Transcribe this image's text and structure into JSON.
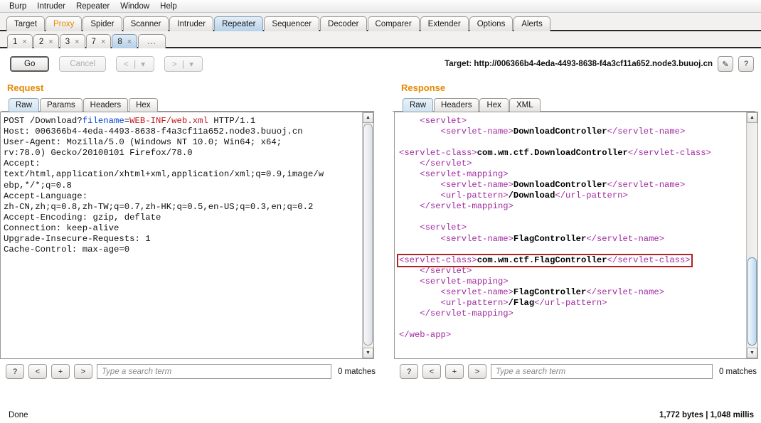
{
  "menu": {
    "items": [
      "Burp",
      "Intruder",
      "Repeater",
      "Window",
      "Help"
    ]
  },
  "main_tabs": [
    {
      "label": "Target",
      "state": "normal"
    },
    {
      "label": "Proxy",
      "state": "orange"
    },
    {
      "label": "Spider",
      "state": "normal"
    },
    {
      "label": "Scanner",
      "state": "normal"
    },
    {
      "label": "Intruder",
      "state": "normal"
    },
    {
      "label": "Repeater",
      "state": "active"
    },
    {
      "label": "Sequencer",
      "state": "normal"
    },
    {
      "label": "Decoder",
      "state": "normal"
    },
    {
      "label": "Comparer",
      "state": "normal"
    },
    {
      "label": "Extender",
      "state": "normal"
    },
    {
      "label": "Options",
      "state": "normal"
    },
    {
      "label": "Alerts",
      "state": "normal"
    }
  ],
  "repeater_tabs": [
    {
      "label": "1",
      "close": "×",
      "active": false
    },
    {
      "label": "2",
      "close": "×",
      "active": false
    },
    {
      "label": "3",
      "close": "×",
      "active": false
    },
    {
      "label": "7",
      "close": "×",
      "active": false
    },
    {
      "label": "8",
      "close": "×",
      "active": true
    }
  ],
  "repeater_tab_more": "...",
  "controls": {
    "go": "Go",
    "cancel": "Cancel",
    "back": "< | ▾",
    "forward": "> | ▾",
    "target_label": "Target: http://006366b4-4eda-4493-8638-f4a3cf11a652.node3.buuoj.cn",
    "edit_icon": "✎",
    "help_icon": "?"
  },
  "request": {
    "title": "Request",
    "tabs": [
      {
        "label": "Raw",
        "active": true
      },
      {
        "label": "Params",
        "active": false
      },
      {
        "label": "Headers",
        "active": false
      },
      {
        "label": "Hex",
        "active": false
      }
    ],
    "lines": [
      "POST /Download?filename=WEB-INF/web.xml HTTP/1.1",
      "Host: 006366b4-4eda-4493-8638-f4a3cf11a652.node3.buuoj.cn",
      "User-Agent: Mozilla/5.0 (Windows NT 10.0; Win64; x64;",
      "rv:78.0) Gecko/20100101 Firefox/78.0",
      "Accept:",
      "text/html,application/xhtml+xml,application/xml;q=0.9,image/w",
      "ebp,*/*;q=0.8",
      "Accept-Language:",
      "zh-CN,zh;q=0.8,zh-TW;q=0.7,zh-HK;q=0.5,en-US;q=0.3,en;q=0.2",
      "Accept-Encoding: gzip, deflate",
      "Connection: keep-alive",
      "Upgrade-Insecure-Requests: 1",
      "Cache-Control: max-age=0"
    ],
    "first_line": {
      "method": "POST /Download?",
      "param_key": "filename",
      "equals": "=",
      "param_value": "WEB-INF/web.xml",
      "protocol": " HTTP/1.1"
    },
    "search_placeholder": "Type a search term",
    "search_value": "",
    "matches": "0 matches",
    "buttons": [
      "?",
      "<",
      "+",
      ">"
    ]
  },
  "response": {
    "title": "Response",
    "tabs": [
      {
        "label": "Raw",
        "active": true
      },
      {
        "label": "Headers",
        "active": false
      },
      {
        "label": "Hex",
        "active": false
      },
      {
        "label": "XML",
        "active": false
      }
    ],
    "xml_lines": [
      {
        "indent": 4,
        "tag_open": "<servlet>",
        "value": "",
        "tag_close": "",
        "highlight": false
      },
      {
        "indent": 8,
        "tag_open": "<servlet-name>",
        "value": "DownloadController",
        "tag_close": "</servlet-name>",
        "highlight": false
      },
      {
        "indent": 0,
        "tag_open": "",
        "value": "",
        "tag_close": "",
        "highlight": false
      },
      {
        "indent": 0,
        "tag_open": "<servlet-class>",
        "value": "com.wm.ctf.DownloadController",
        "tag_close": "</servlet-class>",
        "highlight": false
      },
      {
        "indent": 4,
        "tag_open": "</servlet>",
        "value": "",
        "tag_close": "",
        "highlight": false
      },
      {
        "indent": 4,
        "tag_open": "<servlet-mapping>",
        "value": "",
        "tag_close": "",
        "highlight": false
      },
      {
        "indent": 8,
        "tag_open": "<servlet-name>",
        "value": "DownloadController",
        "tag_close": "</servlet-name>",
        "highlight": false
      },
      {
        "indent": 8,
        "tag_open": "<url-pattern>",
        "value": "/Download",
        "tag_close": "</url-pattern>",
        "highlight": false
      },
      {
        "indent": 4,
        "tag_open": "</servlet-mapping>",
        "value": "",
        "tag_close": "",
        "highlight": false
      },
      {
        "indent": 0,
        "tag_open": "",
        "value": "",
        "tag_close": "",
        "highlight": false
      },
      {
        "indent": 4,
        "tag_open": "<servlet>",
        "value": "",
        "tag_close": "",
        "highlight": false
      },
      {
        "indent": 8,
        "tag_open": "<servlet-name>",
        "value": "FlagController",
        "tag_close": "</servlet-name>",
        "highlight": false
      },
      {
        "indent": 0,
        "tag_open": "",
        "value": "",
        "tag_close": "",
        "highlight": false
      },
      {
        "indent": 0,
        "tag_open": "<servlet-class>",
        "value": "com.wm.ctf.FlagController",
        "tag_close": "</servlet-class>",
        "highlight": true
      },
      {
        "indent": 4,
        "tag_open": "</servlet>",
        "value": "",
        "tag_close": "",
        "highlight": false
      },
      {
        "indent": 4,
        "tag_open": "<servlet-mapping>",
        "value": "",
        "tag_close": "",
        "highlight": false
      },
      {
        "indent": 8,
        "tag_open": "<servlet-name>",
        "value": "FlagController",
        "tag_close": "</servlet-name>",
        "highlight": false
      },
      {
        "indent": 8,
        "tag_open": "<url-pattern>",
        "value": "/Flag",
        "tag_close": "</url-pattern>",
        "highlight": false
      },
      {
        "indent": 4,
        "tag_open": "</servlet-mapping>",
        "value": "",
        "tag_close": "",
        "highlight": false
      },
      {
        "indent": 0,
        "tag_open": "",
        "value": "",
        "tag_close": "",
        "highlight": false
      },
      {
        "indent": 0,
        "tag_open": "</web-app>",
        "value": "",
        "tag_close": "",
        "highlight": false
      }
    ],
    "search_placeholder": "Type a search term",
    "search_value": "",
    "matches": "0 matches",
    "buttons": [
      "?",
      "<",
      "+",
      ">"
    ]
  },
  "status": {
    "left": "Done",
    "right": "1,772 bytes | 1,048 millis"
  },
  "colors": {
    "accent_orange": "#e58900",
    "active_tab_blue": "#c0d8ec",
    "highlight_box": "#b22222",
    "xml_tag": "#a02ba0",
    "param_key": "#0b44d6",
    "param_value": "#c01818"
  }
}
